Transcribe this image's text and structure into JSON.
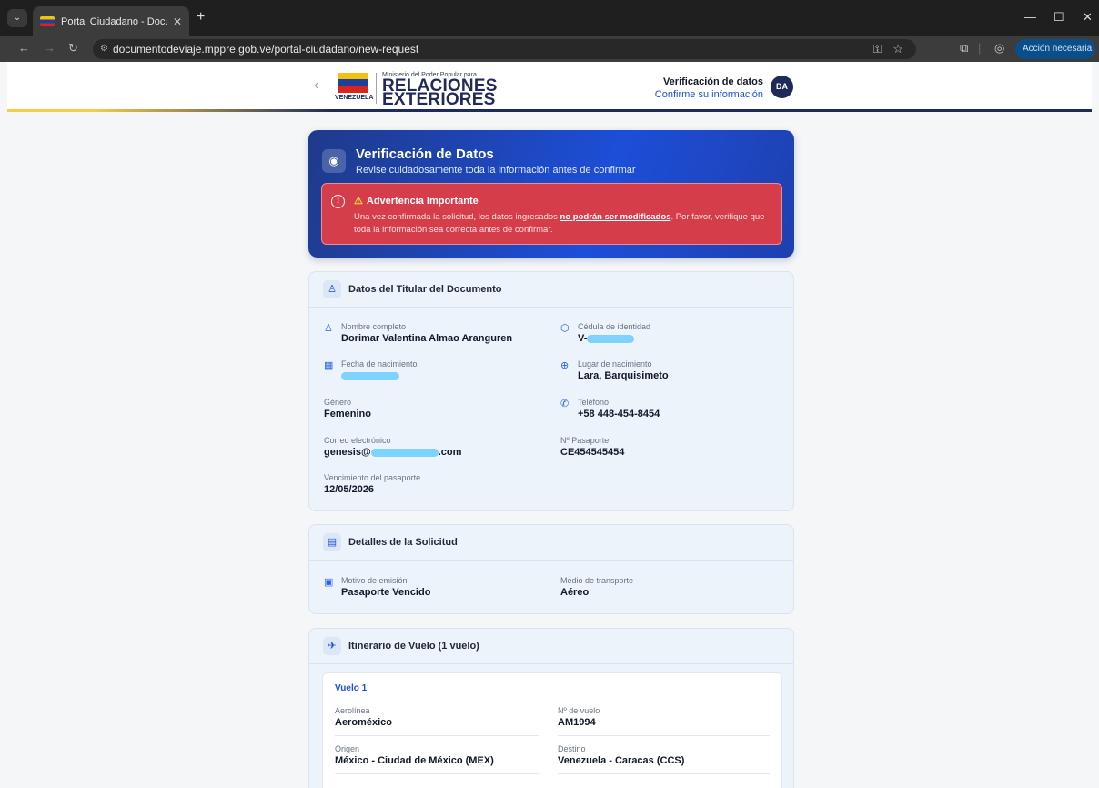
{
  "browser": {
    "tab_title": "Portal Ciudadano - Documento",
    "url": "documentodeviaje.mppre.gob.ve/portal-ciudadano/new-request",
    "action_label": "Acción necesaria"
  },
  "header": {
    "logo_top": "Ministerio del Poder Popular para",
    "logo_line1": "RELACIONES",
    "logo_line2": "EXTERIORES",
    "logo_country": "VENEZUELA",
    "title": "Verificación de datos",
    "subtitle": "Confirme su información",
    "avatar_initials": "DA"
  },
  "hero": {
    "title": "Verificación de Datos",
    "subtitle": "Revise cuidadosamente toda la información antes de confirmar",
    "warning_title": "Advertencia Importante",
    "warning_pre": "Una vez confirmada la solicitud, los datos ingresados ",
    "warning_bold": "no podrán ser modificados",
    "warning_post": ". Por favor, verifique que toda la información sea correcta antes de confirmar."
  },
  "titular": {
    "section_title": "Datos del Titular del Documento",
    "nombre_label": "Nombre completo",
    "nombre": "Dorimar Valentina Almao Aranguren",
    "cedula_label": "Cédula de identidad",
    "cedula_prefix": "V-",
    "fecha_label": "Fecha de nacimiento",
    "lugar_label": "Lugar de nacimiento",
    "lugar": "Lara, Barquisimeto",
    "genero_label": "Género",
    "genero": "Femenino",
    "telefono_label": "Teléfono",
    "telefono": "+58 448-454-8454",
    "correo_label": "Correo electrónico",
    "correo_prefix": "genesis@",
    "correo_suffix": ".com",
    "pasaporte_label": "Nº Pasaporte",
    "pasaporte": "CE454545454",
    "vencimiento_label": "Vencimiento del pasaporte",
    "vencimiento": "12/05/2026"
  },
  "solicitud": {
    "section_title": "Detalles de la Solicitud",
    "motivo_label": "Motivo de emisión",
    "motivo": "Pasaporte Vencido",
    "medio_label": "Medio de transporte",
    "medio": "Aéreo"
  },
  "itinerario": {
    "section_title": "Itinerario de Vuelo (1 vuelo)",
    "vuelo_title": "Vuelo 1",
    "aerolinea_label": "Aerolínea",
    "aerolinea": "Aeroméxico",
    "numero_label": "Nº de vuelo",
    "numero": "AM1994",
    "origen_label": "Origen",
    "origen": "México - Ciudad de México (MEX)",
    "destino_label": "Destino",
    "destino": "Venezuela - Caracas (CCS)"
  }
}
